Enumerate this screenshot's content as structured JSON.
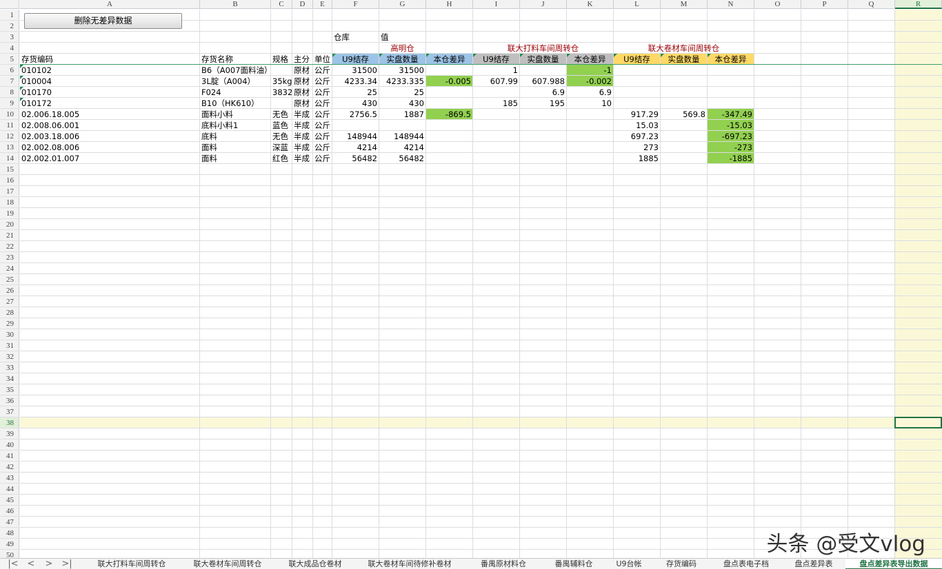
{
  "toolbar": {
    "delete_button_label": "删除无差异数据"
  },
  "columns": [
    "A",
    "B",
    "C",
    "D",
    "E",
    "F",
    "G",
    "H",
    "I",
    "J",
    "K",
    "L",
    "M",
    "N",
    "O",
    "P",
    "Q",
    "R"
  ],
  "selected_column": "R",
  "selected_row": 38,
  "row_numbers": [
    "1",
    "2",
    "3",
    "4",
    "5",
    "6",
    "7",
    "8",
    "9",
    "10",
    "11",
    "12",
    "13",
    "14",
    "15",
    "16",
    "17",
    "18",
    "19",
    "20",
    "21",
    "22",
    "23",
    "24",
    "25",
    "26",
    "27",
    "28",
    "29",
    "30",
    "31",
    "32",
    "33",
    "34",
    "35",
    "36",
    "37",
    "38",
    "39",
    "40",
    "41",
    "42",
    "43",
    "44",
    "45",
    "46",
    "47",
    "48",
    "49",
    "50"
  ],
  "header": {
    "warehouse_label": "仓库",
    "value_label": "值",
    "groups": [
      "高明仓",
      "联大打料车间周转仓",
      "联大卷材车间周转仓"
    ],
    "col_a": "存货编码",
    "col_b": "存货名称",
    "col_c": "规格",
    "col_d": "主分",
    "col_e": "单位",
    "sub": [
      "U9结存",
      "实盘数量",
      "本仓差异",
      "U9结存",
      "实盘数量",
      "本仓差异",
      "U9结存",
      "实盘数量",
      "本仓差异"
    ]
  },
  "rows": [
    {
      "a": "010102",
      "b": "B6（A007面料油）",
      "c": "",
      "d": "原材",
      "e": "公斤",
      "f": "31500",
      "g": "31500",
      "h": "",
      "i": "1",
      "j": "",
      "k": "-1",
      "l": "",
      "m": "",
      "n": ""
    },
    {
      "a": "010004",
      "b": "3L腚（A004）",
      "c": "35kg",
      "d": "原材",
      "e": "公斤",
      "f": "4233.34",
      "g": "4233.335",
      "h": "-0.005",
      "i": "607.99",
      "j": "607.988",
      "k": "-0.002",
      "l": "",
      "m": "",
      "n": ""
    },
    {
      "a": "010170",
      "b": "F024",
      "c": "3832",
      "d": "原材",
      "e": "公斤",
      "f": "25",
      "g": "25",
      "h": "",
      "i": "",
      "j": "6.9",
      "k": "6.9",
      "l": "",
      "m": "",
      "n": ""
    },
    {
      "a": "010172",
      "b": "B10（HK610）",
      "c": "",
      "d": "原材",
      "e": "公斤",
      "f": "430",
      "g": "430",
      "h": "",
      "i": "185",
      "j": "195",
      "k": "10",
      "l": "",
      "m": "",
      "n": ""
    },
    {
      "a": "02.006.18.005",
      "b": "面料小料",
      "c": "无色",
      "d": "半成",
      "e": "公斤",
      "f": "2756.5",
      "g": "1887",
      "h": "-869.5",
      "i": "",
      "j": "",
      "k": "",
      "l": "917.29",
      "m": "569.8",
      "n": "-347.49"
    },
    {
      "a": "02.008.06.001",
      "b": "底料小料1",
      "c": "蓝色",
      "d": "半成",
      "e": "公斤",
      "f": "",
      "g": "",
      "h": "",
      "i": "",
      "j": "",
      "k": "",
      "l": "15.03",
      "m": "",
      "n": "-15.03"
    },
    {
      "a": "02.003.18.006",
      "b": "底料",
      "c": "无色",
      "d": "半成",
      "e": "公斤",
      "f": "148944",
      "g": "148944",
      "h": "",
      "i": "",
      "j": "",
      "k": "",
      "l": "697.23",
      "m": "",
      "n": "-697.23"
    },
    {
      "a": "02.002.08.006",
      "b": "面料",
      "c": "深蓝",
      "d": "半成",
      "e": "公斤",
      "f": "4214",
      "g": "4214",
      "h": "",
      "i": "",
      "j": "",
      "k": "",
      "l": "273",
      "m": "",
      "n": "-273"
    },
    {
      "a": "02.002.01.007",
      "b": "面料",
      "c": "红色",
      "d": "半成",
      "e": "公斤",
      "f": "56482",
      "g": "56482",
      "h": "",
      "i": "",
      "j": "",
      "k": "",
      "l": "1885",
      "m": "",
      "n": "-1885"
    }
  ],
  "highlight_cells": [
    {
      "row": 6,
      "col": "k"
    },
    {
      "row": 7,
      "col": "h"
    },
    {
      "row": 7,
      "col": "k"
    },
    {
      "row": 10,
      "col": "h"
    },
    {
      "row": 10,
      "col": "n"
    },
    {
      "row": 11,
      "col": "n"
    },
    {
      "row": 12,
      "col": "n"
    },
    {
      "row": 13,
      "col": "n"
    },
    {
      "row": 14,
      "col": "n"
    }
  ],
  "tabs": [
    {
      "label": "联大打料车间周转仓",
      "active": false
    },
    {
      "label": "联大卷材车间周转仓",
      "active": false
    },
    {
      "label": "联大成品仓卷材",
      "active": false
    },
    {
      "label": "联大卷材车间待修补卷材",
      "active": false
    },
    {
      "label": "番禺原材料仓",
      "active": false
    },
    {
      "label": "番禺辅料仓",
      "active": false
    },
    {
      "label": "U9台帐",
      "active": false
    },
    {
      "label": "存货编码",
      "active": false
    },
    {
      "label": "盘点表电子档",
      "active": false
    },
    {
      "label": "盘点差异表",
      "active": false
    },
    {
      "label": "盘点差异表导出数据",
      "active": true
    }
  ],
  "tab_nav": [
    "|<",
    "<",
    ">",
    ">|"
  ],
  "colors": {
    "green": "#92d050",
    "blue": "#9dc3e6",
    "gray": "#bfbfbf",
    "yellow": "#ffd966",
    "red_text": "#9c0006",
    "accent": "#217346"
  },
  "watermark": "头条 @受文vlog"
}
